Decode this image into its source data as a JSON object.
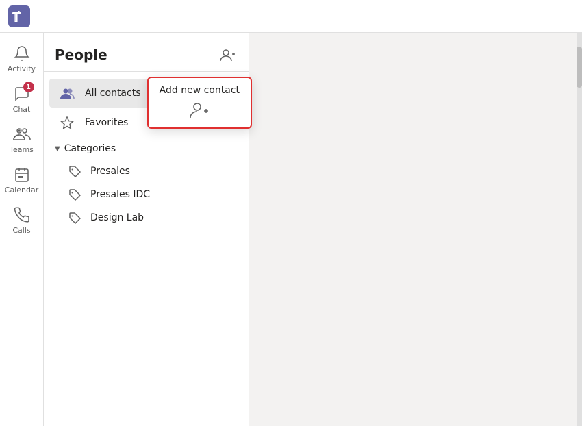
{
  "titlebar": {
    "logo_alt": "Microsoft Teams"
  },
  "sidebar": {
    "items": [
      {
        "id": "activity",
        "label": "Activity",
        "icon": "bell"
      },
      {
        "id": "chat",
        "label": "Chat",
        "icon": "chat",
        "badge": "1"
      },
      {
        "id": "teams",
        "label": "Teams",
        "icon": "teams"
      },
      {
        "id": "calendar",
        "label": "Calendar",
        "icon": "calendar"
      },
      {
        "id": "calls",
        "label": "Calls",
        "icon": "calls"
      }
    ]
  },
  "people": {
    "title": "People",
    "add_contact_tooltip": "Add new contact",
    "contacts": [
      {
        "id": "all",
        "name": "All contacts",
        "icon": "contacts",
        "active": true
      },
      {
        "id": "favorites",
        "name": "Favorites",
        "icon": "star"
      }
    ],
    "categories": {
      "label": "Categories",
      "items": [
        {
          "id": "presales",
          "name": "Presales"
        },
        {
          "id": "presales-idc",
          "name": "Presales IDC"
        },
        {
          "id": "design-lab",
          "name": "Design Lab"
        }
      ]
    }
  },
  "colors": {
    "accent": "#6264a7",
    "badge": "#c4314b",
    "tooltip_border": "#e03030"
  }
}
